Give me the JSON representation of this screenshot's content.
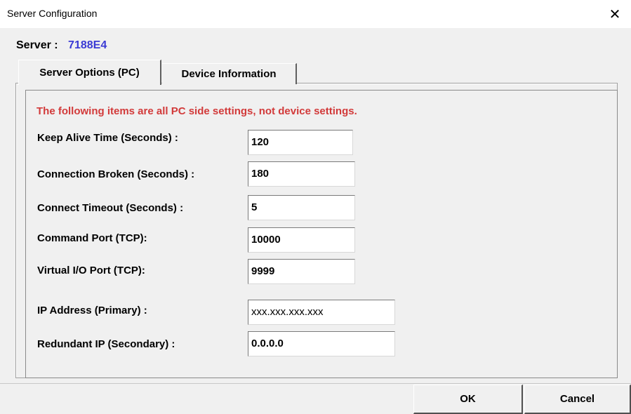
{
  "window": {
    "title": "Server Configuration",
    "close_glyph": "✕"
  },
  "server": {
    "label": "Server :",
    "value": "7188E4"
  },
  "tabs": [
    {
      "label": "Server Options (PC)",
      "active": true
    },
    {
      "label": "Device Information",
      "active": false
    }
  ],
  "notice": "The following items are all PC side settings, not device settings.",
  "fields": {
    "keep_alive": {
      "label": "Keep Alive Time (Seconds) :",
      "value": "120"
    },
    "connection_broken": {
      "label": "Connection Broken (Seconds) :",
      "value": "180"
    },
    "connect_timeout": {
      "label": "Connect Timeout (Seconds) :",
      "value": "5"
    },
    "command_port": {
      "label": "Command Port (TCP):",
      "value": "10000"
    },
    "virtual_io_port": {
      "label": "Virtual I/O Port (TCP):",
      "value": "9999"
    },
    "ip_primary": {
      "label": "IP Address (Primary) :",
      "value": "xxx.xxx.xxx.xxx"
    },
    "ip_redundant": {
      "label": "Redundant IP (Secondary) :",
      "value": "0.0.0.0"
    }
  },
  "buttons": {
    "ok": "OK",
    "cancel": "Cancel"
  },
  "colors": {
    "server_value": "#3a3ad4",
    "notice": "#d23a3a",
    "background": "#f0f0f0"
  }
}
